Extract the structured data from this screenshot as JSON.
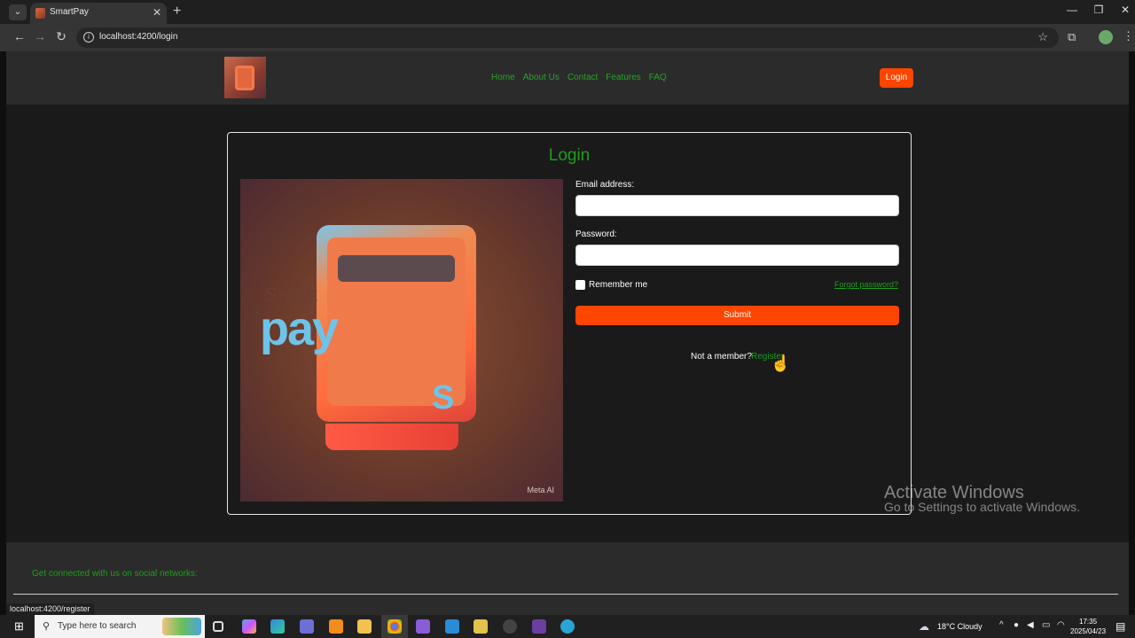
{
  "browser": {
    "tab_title": "SmartPay",
    "url": "localhost:4200/login",
    "status_url": "localhost:4200/register"
  },
  "site_nav": {
    "links": [
      "Home",
      "About Us",
      "Contact",
      "Features",
      "FAQ"
    ],
    "login_label": "Login"
  },
  "login_card": {
    "title": "Login",
    "email_label": "Email address:",
    "email_value": "",
    "password_label": "Password:",
    "password_value": "",
    "remember_label": "Remember me",
    "remember_checked": false,
    "forgot_label": "Forgot password?",
    "submit_label": "Submit",
    "not_member_text": "Not a member?",
    "register_label": "Register",
    "hero_image": {
      "brand_text_top": "Smart",
      "brand_text_main": "pay",
      "brand_text_s": "S",
      "watermark": "Meta AI"
    }
  },
  "footer": {
    "social_text": "Get connected with us on social networks:"
  },
  "os_overlay": {
    "activate_title": "Activate Windows",
    "activate_sub": "Go to Settings to activate Windows."
  },
  "taskbar": {
    "search_placeholder": "Type here to search",
    "weather": "18°C  Cloudy",
    "time": "17:35",
    "date": "2025/04/23"
  },
  "colors": {
    "accent_orange": "#ff4500",
    "link_green": "#1c9e1c",
    "page_bg": "#1a1a1a",
    "nav_bg": "#2b2b2b"
  }
}
